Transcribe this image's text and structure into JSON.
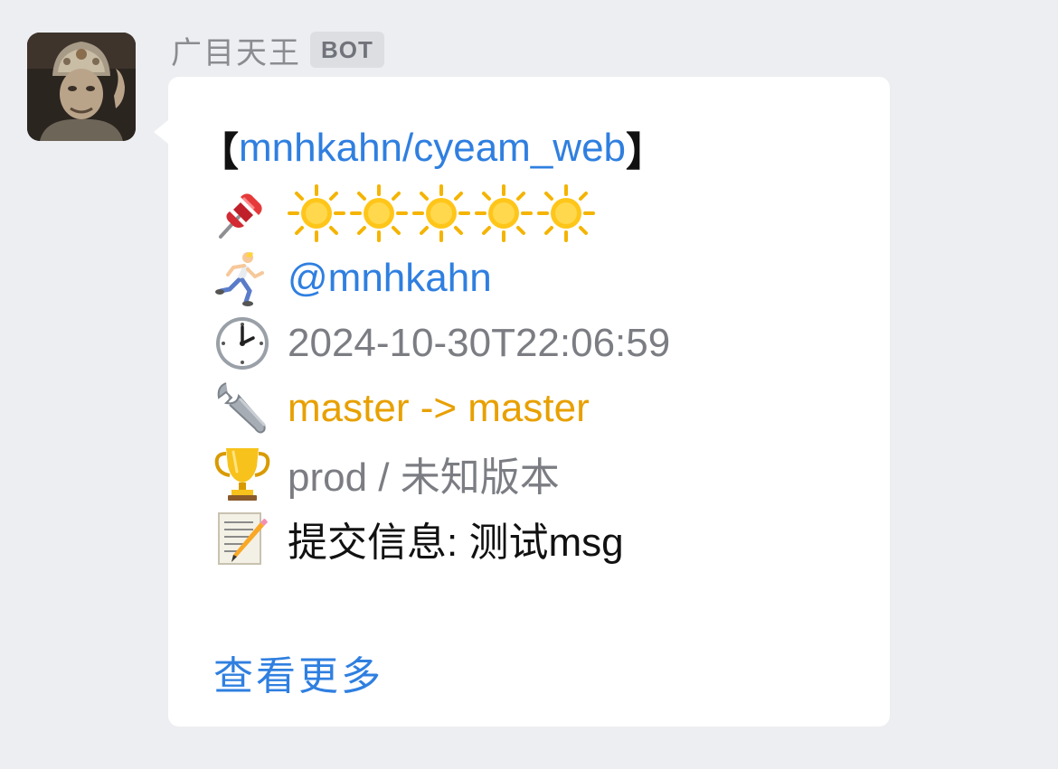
{
  "sender": {
    "name": "广目天王",
    "badge": "BOT"
  },
  "message": {
    "repo_open": "【",
    "repo": "mnhkahn/cyeam_web",
    "repo_close": "】",
    "rating": {
      "pin_icon": "pushpin-icon",
      "sun_icon": "sun-icon",
      "count": 5
    },
    "author_icon": "runner-icon",
    "author": "@mnhkahn",
    "time_icon": "clock-icon",
    "timestamp": "2024-10-30T22:06:59",
    "branch_icon": "wrench-icon",
    "branch": "master -> master",
    "env_icon": "trophy-icon",
    "environment": "prod / 未知版本",
    "commit_icon": "memo-icon",
    "commit": "提交信息: 测试msg"
  },
  "actions": {
    "view_more": "查看更多"
  },
  "colors": {
    "background": "#edeef1",
    "link": "#2f7fe0",
    "branch": "#e8a000",
    "muted": "#7b7d83"
  }
}
